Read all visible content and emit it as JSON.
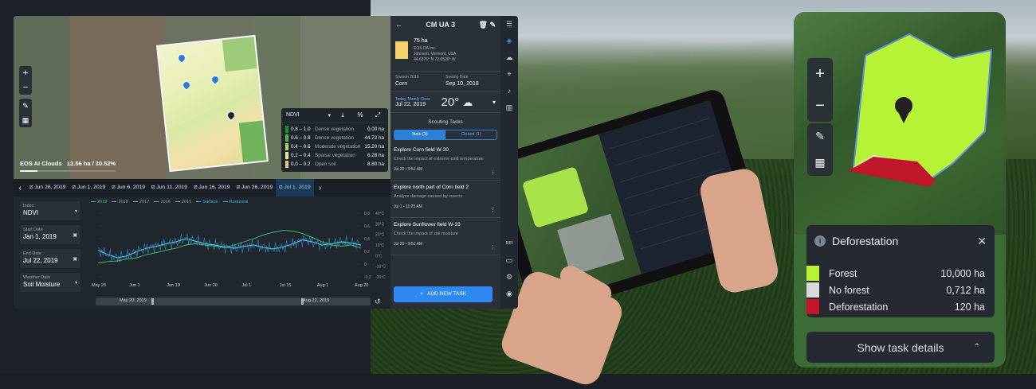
{
  "map": {
    "info_label": "EOS AI Clouds",
    "info_value": "12.56 ha / 30.52%",
    "zoom_in": "+",
    "zoom_out": "−"
  },
  "legend": {
    "index": "NDVI",
    "rows": [
      {
        "range": "0.8 – 1.0",
        "label": "Dense vegetation",
        "value": "0.00 ha",
        "color": "#1e8f2c"
      },
      {
        "range": "0.6 – 0.8",
        "label": "Dense vegetation",
        "value": "44.72 ha",
        "color": "#59b24a"
      },
      {
        "range": "0.4 – 0.6",
        "label": "Moderate vegetation",
        "value": "15.20 ha",
        "color": "#a8d76b"
      },
      {
        "range": "0.2 – 0.4",
        "label": "Sparse vegetation",
        "value": "6.28 ha",
        "color": "#e8ec9a"
      },
      {
        "range": "0.0 – 0.2",
        "label": "Open soil",
        "value": "8.80 ha",
        "color": "#e6c98a"
      }
    ]
  },
  "dates": [
    "Jun 26, 2019",
    "Jun 1, 2019",
    "Jun 6, 2019",
    "Jun 11, 2019",
    "Jun 16, 2019",
    "Jun 26, 2019",
    "Jul 1, 2019"
  ],
  "form": {
    "index_label": "Index",
    "index_value": "NDVI",
    "start_label": "Start Date",
    "start_value": "Jan 1, 2019",
    "end_label": "End Date",
    "end_value": "Jul 22, 2019",
    "weather_label": "Weather Data",
    "weather_value": "Soil Moisture"
  },
  "chart_data": {
    "type": "line",
    "series": [
      {
        "name": "2019",
        "color": "#3dcc6b"
      },
      {
        "name": "2018",
        "color": "#8d96a0"
      },
      {
        "name": "2017",
        "color": "#8d96a0"
      },
      {
        "name": "2016",
        "color": "#8d96a0"
      },
      {
        "name": "2015",
        "color": "#8d96a0"
      },
      {
        "name": "Surface",
        "color": "#35b5e6"
      },
      {
        "name": "Rootzone",
        "color": "#35b5e6"
      }
    ],
    "x_ticks": [
      "May 20",
      "Jun 1",
      "Jun 10",
      "Jun 20",
      "Jul 1",
      "Jul 15",
      "Aug 1",
      "Aug 20"
    ],
    "y_ticks_left": [
      "0.8",
      "0.6",
      "0.4",
      "0.2",
      "0",
      "-0.2"
    ],
    "y_ticks_right": [
      "40°C",
      "30°C",
      "20°C",
      "10°C",
      "0°C",
      "-10°C",
      "-20°C"
    ],
    "green_points": [
      0.22,
      0.24,
      0.25,
      0.28,
      0.3,
      0.35,
      0.38,
      0.42,
      0.45,
      0.5,
      0.52,
      0.5,
      0.48,
      0.46,
      0.5,
      0.55,
      0.6,
      0.66,
      0.7,
      0.73,
      0.72,
      0.68,
      0.62,
      0.55,
      0.5,
      0.48,
      0.5,
      0.45
    ],
    "blue_points": [
      0.42,
      0.35,
      0.3,
      0.33,
      0.4,
      0.45,
      0.48,
      0.52,
      0.55,
      0.6,
      0.56,
      0.52,
      0.5,
      0.47,
      0.45,
      0.48,
      0.5,
      0.46,
      0.44,
      0.47,
      0.52,
      0.58,
      0.55,
      0.5,
      0.52,
      0.55,
      0.53,
      0.5
    ],
    "range_start": "May 20, 2019",
    "range_end": "Aug 22, 2019"
  },
  "sidebar": {
    "title": "CM UA 3",
    "area": "75 ha",
    "company": "EOS DA Inc.",
    "location": "Johnson, Vermont, USA",
    "coords": "44.6376° N 72.6526° W",
    "season_label": "Season 2019",
    "season_value": "Corn",
    "sowing_label": "Sowing Date",
    "sowing_value": "Sep 10, 2018",
    "weather_line": "Today, Mainly Clear",
    "weather_date": "Jul 22, 2019",
    "temperature": "20°",
    "scouting_title": "Scouting Tasks",
    "tab_new": "New (2)",
    "tab_closed": "Closed (1)",
    "tasks": [
      {
        "title": "Explore Corn field W-20",
        "desc": "Check the impact of extreme cold temperature",
        "time": "Jul 20 • 9:51 AM"
      },
      {
        "title": "Explore north part of Corn field 2",
        "desc": "Analyze damage caused by insects",
        "time": "Jul 1 • 11:25 AM"
      },
      {
        "title": "Explore Sunflower field W-23",
        "desc": "Check the impact of soil moisture",
        "time": "Jul 20 • 9:51 AM"
      }
    ],
    "add_task": "ADD NEW TASK",
    "rfi": "RFI"
  },
  "deforestation": {
    "title": "Deforestation",
    "rows": [
      {
        "label": "Forest",
        "value": "10,000 ha",
        "color": "#b6f236"
      },
      {
        "label": "No forest",
        "value": "0,712 ha",
        "color": "#d9d9d9"
      },
      {
        "label": "Deforestation",
        "value": "120 ha",
        "color": "#c0182a"
      }
    ],
    "show_details": "Show task details"
  }
}
